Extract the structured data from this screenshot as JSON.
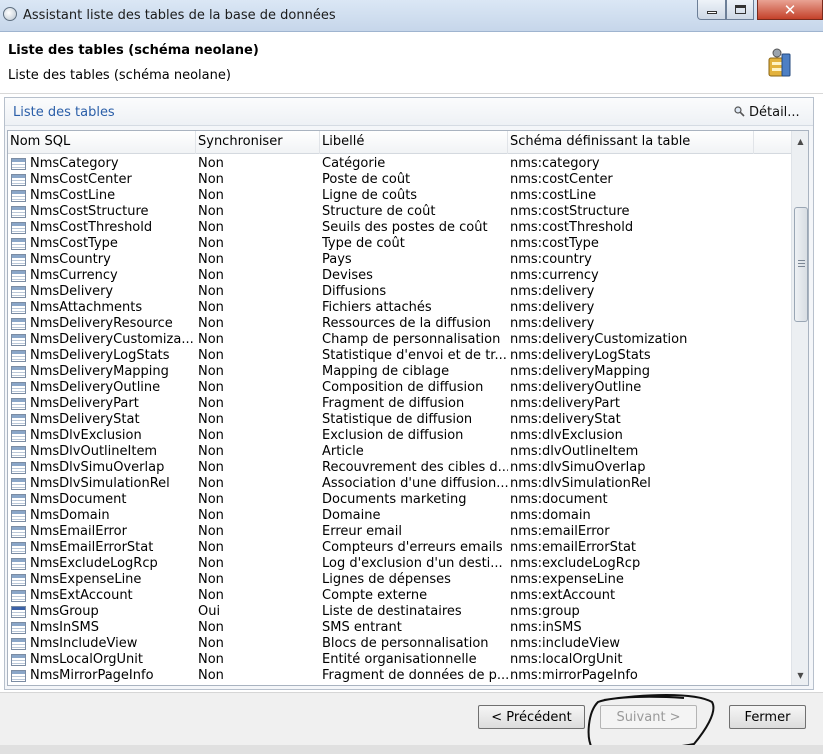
{
  "window": {
    "title": "Assistant liste des tables de la base de données"
  },
  "header": {
    "title": "Liste des tables (schéma neolane)",
    "subtitle": "Liste des tables (schéma neolane)"
  },
  "panel": {
    "title": "Liste des tables",
    "detail_label": "Détail..."
  },
  "columns": [
    "Nom SQL",
    "Synchroniser",
    "Libellé",
    "Schéma définissant la table"
  ],
  "rows": [
    {
      "name": "NmsCategory",
      "sync": "Non",
      "label": "Catégorie",
      "schema": "nms:category"
    },
    {
      "name": "NmsCostCenter",
      "sync": "Non",
      "label": "Poste de coût",
      "schema": "nms:costCenter"
    },
    {
      "name": "NmsCostLine",
      "sync": "Non",
      "label": "Ligne de coûts",
      "schema": "nms:costLine"
    },
    {
      "name": "NmsCostStructure",
      "sync": "Non",
      "label": "Structure de coût",
      "schema": "nms:costStructure"
    },
    {
      "name": "NmsCostThreshold",
      "sync": "Non",
      "label": "Seuils des postes de coût",
      "schema": "nms:costThreshold"
    },
    {
      "name": "NmsCostType",
      "sync": "Non",
      "label": "Type de coût",
      "schema": "nms:costType"
    },
    {
      "name": "NmsCountry",
      "sync": "Non",
      "label": "Pays",
      "schema": "nms:country"
    },
    {
      "name": "NmsCurrency",
      "sync": "Non",
      "label": "Devises",
      "schema": "nms:currency"
    },
    {
      "name": "NmsDelivery",
      "sync": "Non",
      "label": "Diffusions",
      "schema": "nms:delivery"
    },
    {
      "name": "NmsAttachments",
      "sync": "Non",
      "label": "Fichiers attachés",
      "schema": "nms:delivery"
    },
    {
      "name": "NmsDeliveryResource",
      "sync": "Non",
      "label": "Ressources de la diffusion",
      "schema": "nms:delivery"
    },
    {
      "name": "NmsDeliveryCustomiza...",
      "sync": "Non",
      "label": "Champ de personnalisation",
      "schema": "nms:deliveryCustomization"
    },
    {
      "name": "NmsDeliveryLogStats",
      "sync": "Non",
      "label": "Statistique d'envoi et de tr...",
      "schema": "nms:deliveryLogStats"
    },
    {
      "name": "NmsDeliveryMapping",
      "sync": "Non",
      "label": "Mapping de ciblage",
      "schema": "nms:deliveryMapping"
    },
    {
      "name": "NmsDeliveryOutline",
      "sync": "Non",
      "label": "Composition de diffusion",
      "schema": "nms:deliveryOutline"
    },
    {
      "name": "NmsDeliveryPart",
      "sync": "Non",
      "label": "Fragment de diffusion",
      "schema": "nms:deliveryPart"
    },
    {
      "name": "NmsDeliveryStat",
      "sync": "Non",
      "label": "Statistique de diffusion",
      "schema": "nms:deliveryStat"
    },
    {
      "name": "NmsDlvExclusion",
      "sync": "Non",
      "label": "Exclusion de diffusion",
      "schema": "nms:dlvExclusion"
    },
    {
      "name": "NmsDlvOutlineItem",
      "sync": "Non",
      "label": "Article",
      "schema": "nms:dlvOutlineItem"
    },
    {
      "name": "NmsDlvSimuOverlap",
      "sync": "Non",
      "label": "Recouvrement des cibles d...",
      "schema": "nms:dlvSimuOverlap"
    },
    {
      "name": "NmsDlvSimulationRel",
      "sync": "Non",
      "label": "Association d'une diffusion...",
      "schema": "nms:dlvSimulationRel"
    },
    {
      "name": "NmsDocument",
      "sync": "Non",
      "label": "Documents marketing",
      "schema": "nms:document"
    },
    {
      "name": "NmsDomain",
      "sync": "Non",
      "label": "Domaine",
      "schema": "nms:domain"
    },
    {
      "name": "NmsEmailError",
      "sync": "Non",
      "label": "Erreur email",
      "schema": "nms:emailError"
    },
    {
      "name": "NmsEmailErrorStat",
      "sync": "Non",
      "label": "Compteurs d'erreurs emails",
      "schema": "nms:emailErrorStat"
    },
    {
      "name": "NmsExcludeLogRcp",
      "sync": "Non",
      "label": "Log d'exclusion d'un desti...",
      "schema": "nms:excludeLogRcp"
    },
    {
      "name": "NmsExpenseLine",
      "sync": "Non",
      "label": "Lignes de dépenses",
      "schema": "nms:expenseLine"
    },
    {
      "name": "NmsExtAccount",
      "sync": "Non",
      "label": "Compte externe",
      "schema": "nms:extAccount"
    },
    {
      "name": "NmsGroup",
      "sync": "Oui",
      "label": "Liste de destinataires",
      "schema": "nms:group"
    },
    {
      "name": "NmsInSMS",
      "sync": "Non",
      "label": "SMS entrant",
      "schema": "nms:inSMS"
    },
    {
      "name": "NmsIncludeView",
      "sync": "Non",
      "label": "Blocs de personnalisation",
      "schema": "nms:includeView"
    },
    {
      "name": "NmsLocalOrgUnit",
      "sync": "Non",
      "label": "Entité organisationnelle",
      "schema": "nms:localOrgUnit"
    },
    {
      "name": "NmsMirrorPageInfo",
      "sync": "Non",
      "label": "Fragment de données de p...",
      "schema": "nms:mirrorPageInfo"
    }
  ],
  "buttons": {
    "prev": "< Précédent",
    "next": "Suivant >",
    "close": "Fermer"
  },
  "colors": {
    "accent": "#2a5ea8",
    "title_bar": "#c6d6ea",
    "close_button": "#c4412a"
  }
}
